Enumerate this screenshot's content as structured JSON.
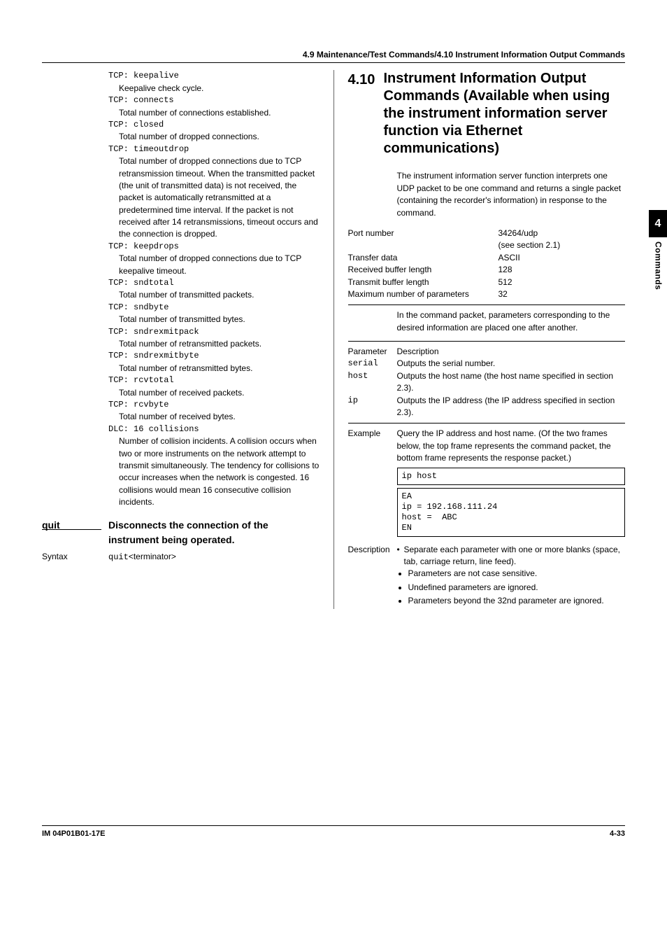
{
  "header": {
    "breadcrumb": "4.9  Maintenance/Test Commands/4.10  Instrument Information Output Commands"
  },
  "sidebar_tab": {
    "number": "4",
    "label": "Commands"
  },
  "footer": {
    "left": "IM 04P01B01-17E",
    "right": "4-33"
  },
  "left": {
    "items": [
      {
        "term": "TCP: keepalive",
        "desc": "Keepalive check cycle."
      },
      {
        "term": "TCP: connects",
        "desc": "Total number of connections established."
      },
      {
        "term": "TCP: closed",
        "desc": "Total number of dropped connections."
      },
      {
        "term": "TCP: timeoutdrop",
        "desc": "Total number of dropped connections due to TCP retransmission timeout. When the transmitted packet (the unit of transmitted data) is not received, the packet is automatically retransmitted at a predetermined time interval. If the packet is not received after 14 retransmissions, timeout occurs and the connection is dropped."
      },
      {
        "term": "TCP: keepdrops",
        "desc": "Total number of dropped connections due to TCP keepalive timeout."
      },
      {
        "term": "TCP: sndtotal",
        "desc": "Total number of transmitted packets."
      },
      {
        "term": "TCP: sndbyte",
        "desc": "Total number of transmitted bytes."
      },
      {
        "term": "TCP: sndrexmitpack",
        "desc": "Total number of retransmitted packets."
      },
      {
        "term": "TCP: sndrexmitbyte",
        "desc": "Total number of retransmitted bytes."
      },
      {
        "term": "TCP: rcvtotal",
        "desc": "Total number of received packets."
      },
      {
        "term": "TCP: rcvbyte",
        "desc": "Total number of received bytes."
      },
      {
        "term": "DLC: 16 collisions",
        "desc": "Number of collision incidents. A collision occurs when two or more instruments on the network attempt to transmit simultaneously. The tendency for collisions to occur increases when the network is congested. 16 collisions would mean 16 consecutive collision incidents."
      }
    ],
    "quit_cmd": {
      "name": "quit",
      "desc": "Disconnects the connection of the instrument being operated.",
      "syntax_label": "Syntax",
      "syntax_cmd": "quit",
      "syntax_suffix": "<terminator>"
    }
  },
  "right": {
    "section_num": "4.10",
    "section_title": "Instrument Information Output Commands (Available when using the instrument information server function via Ethernet communications)",
    "intro": "The instrument information server function interprets one UDP packet to be one command and returns a single packet (containing the recorder's information) in response to the command.",
    "table": [
      {
        "k": "Port number",
        "v": "34264/udp",
        "v2": "(see section 2.1)"
      },
      {
        "k": "Transfer data",
        "v": "ASCII"
      },
      {
        "k": "Received buffer length",
        "v": "128"
      },
      {
        "k": "Transmit buffer length",
        "v": "512"
      },
      {
        "k": "Maximum number of parameters",
        "v": "32"
      }
    ],
    "after_table": "In the command packet, parameters corresponding to the desired information are placed one after another.",
    "param_header_k": "Parameter",
    "param_header_v": "Description",
    "params": [
      {
        "k": "serial",
        "v": "Outputs the serial number."
      },
      {
        "k": "host",
        "v": "Outputs the host name (the host name specified in section 2.3)."
      },
      {
        "k": "ip",
        "v": "Outputs the IP address (the IP address specified in section 2.3)."
      }
    ],
    "example": {
      "label": "Example",
      "text": "Query the IP address and host name. (Of the two frames below, the top frame represents the command packet, the bottom frame represents the response packet.)",
      "box1": "ip host",
      "box2": "EA\nip = 192.168.111.24\nhost =  ABC\nEN"
    },
    "description": {
      "label": "Description",
      "first_bullet": "Separate each parameter with one or more blanks (space, tab, carriage return, line feed).",
      "bullets": [
        "Parameters are not case sensitive.",
        "Undefined parameters are ignored.",
        "Parameters beyond the 32nd parameter are ignored."
      ]
    }
  }
}
